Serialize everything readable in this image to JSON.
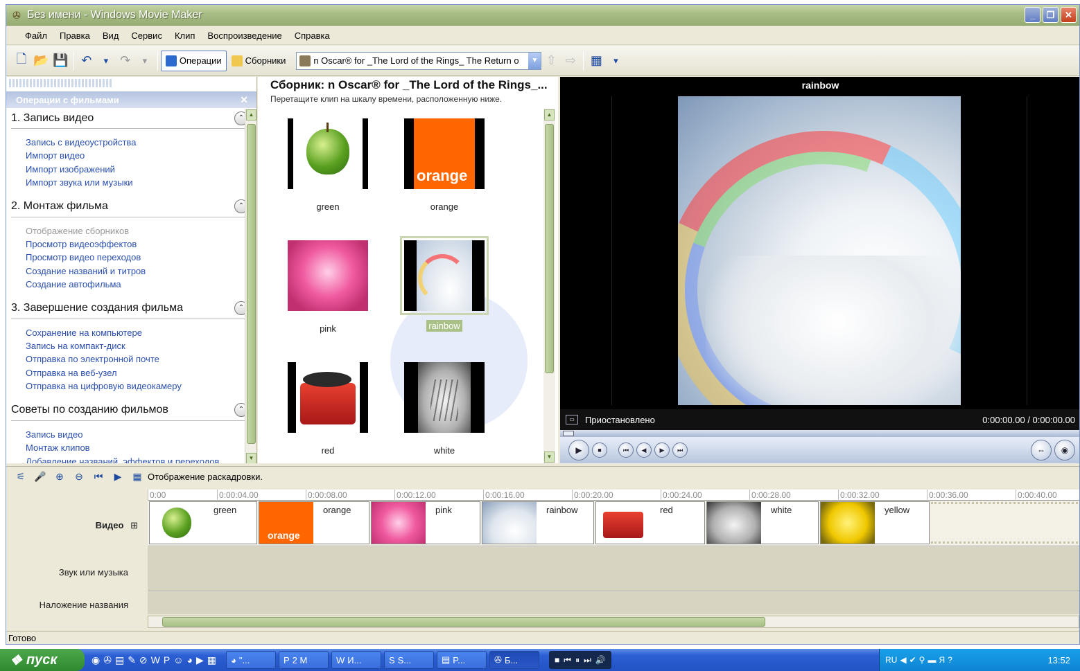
{
  "window": {
    "title": "Без имени - Windows Movie Maker",
    "buttons": [
      "_",
      "❐",
      "✕"
    ]
  },
  "menu": [
    "Файл",
    "Правка",
    "Вид",
    "Сервис",
    "Клип",
    "Воспроизведение",
    "Справка"
  ],
  "toolbar": {
    "operations_label": "Операции",
    "collections_label": "Сборники",
    "collection_select": "n Oscar® for _The Lord of the Rings_ The Return o"
  },
  "taskpane": {
    "header": "Операции с фильмами",
    "sections": [
      {
        "title": "1. Запись видео",
        "links": [
          "Запись с видеоустройства",
          "Импорт видео",
          "Импорт изображений",
          "Импорт звука или музыки"
        ]
      },
      {
        "title": "2. Монтаж фильма",
        "links": [
          "Отображение сборников",
          "Просмотр видеоэффектов",
          "Просмотр видео переходов",
          "Создание названий и титров",
          "Создание автофильма"
        ]
      },
      {
        "title": "3. Завершение создания фильма",
        "links": [
          "Сохранение на компьютере",
          "Запись на компакт-диск",
          "Отправка по электронной почте",
          "Отправка на веб-узел",
          "Отправка на цифровую видеокамеру"
        ]
      },
      {
        "title": "Советы по созданию фильмов",
        "links": [
          "Запись видео",
          "Монтаж клипов",
          "Добавление названий, эффектов и переходов"
        ]
      }
    ]
  },
  "collection": {
    "title": "Сборник: n Oscar® for _The Lord of the Rings_...",
    "hint": "Перетащите клип на шкалу времени, расположенную ниже.",
    "clips": [
      {
        "name": "green",
        "icon": "apple-thumbnail"
      },
      {
        "name": "orange",
        "icon": "orange-logo-thumbnail",
        "logo_text": "orange"
      },
      {
        "name": "pink",
        "icon": "flower-thumbnail"
      },
      {
        "name": "rainbow",
        "icon": "rainbow-thumbnail",
        "selected": true
      },
      {
        "name": "red",
        "icon": "record-player-thumbnail"
      },
      {
        "name": "white",
        "icon": "tiger-thumbnail"
      }
    ]
  },
  "preview": {
    "title": "rainbow",
    "status": "Приостановлено",
    "time": "0:00:00.00 / 0:00:00.00"
  },
  "timeline": {
    "toolbar_label": "Отображение раскадровки.",
    "ruler": [
      "0:00",
      "0:00:04.00",
      "0:00:08.00",
      "0:00:12.00",
      "0:00:16.00",
      "0:00:20.00",
      "0:00:24.00",
      "0:00:28.00",
      "0:00:32.00",
      "0:00:36.00",
      "0:00:40.00"
    ],
    "tracks": {
      "video": "Видео",
      "audio": "Звук или музыка",
      "title": "Наложение названия",
      "expand": "⊞"
    },
    "video_clips": [
      {
        "name": "green",
        "orange_text": ""
      },
      {
        "name": "orange",
        "orange_text": "orange"
      },
      {
        "name": "pink",
        "orange_text": ""
      },
      {
        "name": "rainbow",
        "orange_text": ""
      },
      {
        "name": "red",
        "orange_text": ""
      },
      {
        "name": "white",
        "orange_text": ""
      },
      {
        "name": "yellow",
        "orange_text": ""
      }
    ]
  },
  "statusbar": "Готово",
  "taskbar": {
    "start": "пуск",
    "apps": [
      "\"...",
      "2 M",
      "И...",
      "S...",
      "P...",
      "Б..."
    ],
    "lang": "RU",
    "clock": "13:52"
  }
}
